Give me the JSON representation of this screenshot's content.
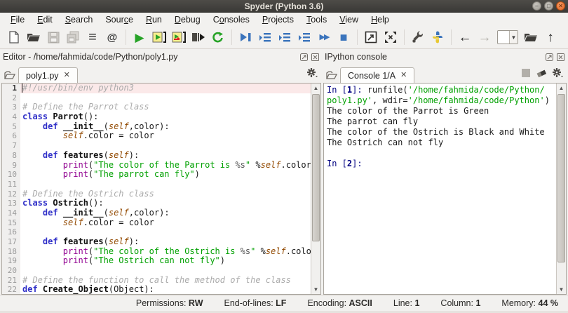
{
  "window": {
    "title": "Spyder (Python 3.6)"
  },
  "menubar": {
    "items": [
      {
        "label": "File",
        "u": 0
      },
      {
        "label": "Edit",
        "u": 0
      },
      {
        "label": "Search",
        "u": 0
      },
      {
        "label": "Source",
        "u": 4
      },
      {
        "label": "Run",
        "u": 0
      },
      {
        "label": "Debug",
        "u": 0
      },
      {
        "label": "Consoles",
        "u": 1
      },
      {
        "label": "Projects",
        "u": 0
      },
      {
        "label": "Tools",
        "u": 0
      },
      {
        "label": "View",
        "u": 0
      },
      {
        "label": "Help",
        "u": 0
      }
    ]
  },
  "toolbar": {
    "icons": [
      {
        "name": "new-file-icon",
        "kind": "doc"
      },
      {
        "name": "open-file-icon",
        "kind": "folder"
      },
      {
        "name": "save-icon",
        "kind": "floppy",
        "disabled": true
      },
      {
        "name": "save-all-icon",
        "kind": "floppy2",
        "disabled": true
      },
      {
        "name": "file-switcher-icon",
        "kind": "glyph",
        "glyph": "≡",
        "color": "#333333",
        "size": 20
      },
      {
        "name": "symbol-finder-icon",
        "kind": "glyph",
        "glyph": "@",
        "color": "#333333",
        "size": 15,
        "bold": true
      },
      {
        "name": "sep",
        "kind": "sep"
      },
      {
        "name": "run-file-icon",
        "kind": "glyph",
        "glyph": "▶",
        "color": "#27a327",
        "size": 17
      },
      {
        "name": "run-cell-icon",
        "kind": "cell"
      },
      {
        "name": "rerun-cell-icon",
        "kind": "cellr"
      },
      {
        "name": "run-selection-icon",
        "kind": "selrun"
      },
      {
        "name": "rerun-last-icon",
        "kind": "rerun"
      },
      {
        "name": "sep",
        "kind": "sep"
      },
      {
        "name": "debug-file-icon",
        "kind": "dbgplay"
      },
      {
        "name": "run-current-line-icon",
        "kind": "step"
      },
      {
        "name": "step-into-icon",
        "kind": "step"
      },
      {
        "name": "step-return-icon",
        "kind": "step"
      },
      {
        "name": "continue-execution-icon",
        "kind": "glyph",
        "glyph": "▶▶",
        "color": "#3b74bc",
        "size": 11,
        "bold": true
      },
      {
        "name": "stop-debug-icon",
        "kind": "glyph",
        "glyph": "■",
        "color": "#3b74bc",
        "size": 18
      },
      {
        "name": "sep",
        "kind": "sep"
      },
      {
        "name": "maximize-pane-icon",
        "kind": "maxpane"
      },
      {
        "name": "fullscreen-icon",
        "kind": "fullscr"
      },
      {
        "name": "sep",
        "kind": "sep"
      },
      {
        "name": "preferences-icon",
        "kind": "wrench"
      },
      {
        "name": "python-path-manager-icon",
        "kind": "python"
      },
      {
        "name": "sep",
        "kind": "sep"
      },
      {
        "name": "back-icon",
        "kind": "glyph",
        "glyph": "←",
        "color": "#222222",
        "size": 19,
        "bold": true
      },
      {
        "name": "forward-icon",
        "kind": "glyph",
        "glyph": "→",
        "color": "#b2afa9",
        "size": 19,
        "bold": true,
        "disabled": true
      },
      {
        "name": "working-directory-combobox",
        "kind": "combo"
      },
      {
        "name": "open-directory-icon",
        "kind": "folder"
      },
      {
        "name": "parent-directory-icon",
        "kind": "glyph",
        "glyph": "↑",
        "color": "#222222",
        "size": 19,
        "bold": true
      }
    ]
  },
  "editor": {
    "header": "Editor - /home/fahmida/code/Python/poly1.py",
    "tab": "poly1.py",
    "lines": [
      {
        "n": "1",
        "cur": true,
        "segs": [
          [
            "c",
            "#!/usr/bin/env python3"
          ]
        ]
      },
      {
        "n": "2",
        "segs": []
      },
      {
        "n": "3",
        "segs": [
          [
            "c",
            "# Define the Parrot class"
          ]
        ]
      },
      {
        "n": "4",
        "segs": [
          [
            "k",
            "class"
          ],
          [
            "p",
            " "
          ],
          [
            "d",
            "Parrot"
          ],
          [
            "p",
            "():"
          ]
        ]
      },
      {
        "n": "5",
        "segs": [
          [
            "p",
            "    "
          ],
          [
            "k",
            "def"
          ],
          [
            "p",
            " "
          ],
          [
            "d",
            "__init__"
          ],
          [
            "p",
            "("
          ],
          [
            "i",
            "self"
          ],
          [
            "p",
            ",color):"
          ]
        ]
      },
      {
        "n": "6",
        "segs": [
          [
            "p",
            "        "
          ],
          [
            "i",
            "self"
          ],
          [
            "p",
            ".color = color"
          ]
        ]
      },
      {
        "n": "7",
        "segs": []
      },
      {
        "n": "8",
        "segs": [
          [
            "p",
            "    "
          ],
          [
            "k",
            "def"
          ],
          [
            "p",
            " "
          ],
          [
            "d",
            "features"
          ],
          [
            "p",
            "("
          ],
          [
            "i",
            "self"
          ],
          [
            "p",
            "):"
          ]
        ]
      },
      {
        "n": "9",
        "segs": [
          [
            "p",
            "        "
          ],
          [
            "b",
            "print"
          ],
          [
            "p",
            "("
          ],
          [
            "s",
            "\"The color of the Parrot is "
          ],
          [
            "f",
            "%s"
          ],
          [
            "s",
            "\""
          ],
          [
            "p",
            " %"
          ],
          [
            "i",
            "self"
          ],
          [
            "p",
            ".color)"
          ]
        ]
      },
      {
        "n": "10",
        "segs": [
          [
            "p",
            "        "
          ],
          [
            "b",
            "print"
          ],
          [
            "p",
            "("
          ],
          [
            "s",
            "\"The parrot can fly\""
          ],
          [
            "p",
            ")"
          ]
        ]
      },
      {
        "n": "11",
        "segs": []
      },
      {
        "n": "12",
        "segs": [
          [
            "c",
            "# Define the Ostrich class"
          ]
        ]
      },
      {
        "n": "13",
        "segs": [
          [
            "k",
            "class"
          ],
          [
            "p",
            " "
          ],
          [
            "d",
            "Ostrich"
          ],
          [
            "p",
            "():"
          ]
        ]
      },
      {
        "n": "14",
        "segs": [
          [
            "p",
            "    "
          ],
          [
            "k",
            "def"
          ],
          [
            "p",
            " "
          ],
          [
            "d",
            "__init__"
          ],
          [
            "p",
            "("
          ],
          [
            "i",
            "self"
          ],
          [
            "p",
            ",color):"
          ]
        ]
      },
      {
        "n": "15",
        "segs": [
          [
            "p",
            "        "
          ],
          [
            "i",
            "self"
          ],
          [
            "p",
            ".color = color"
          ]
        ]
      },
      {
        "n": "16",
        "segs": []
      },
      {
        "n": "17",
        "segs": [
          [
            "p",
            "    "
          ],
          [
            "k",
            "def"
          ],
          [
            "p",
            " "
          ],
          [
            "d",
            "features"
          ],
          [
            "p",
            "("
          ],
          [
            "i",
            "self"
          ],
          [
            "p",
            "):"
          ]
        ]
      },
      {
        "n": "18",
        "segs": [
          [
            "p",
            "        "
          ],
          [
            "b",
            "print"
          ],
          [
            "p",
            "("
          ],
          [
            "s",
            "\"The color of the Ostrich is "
          ],
          [
            "f",
            "%s"
          ],
          [
            "s",
            "\""
          ],
          [
            "p",
            " %"
          ],
          [
            "i",
            "self"
          ],
          [
            "p",
            ".color)"
          ]
        ]
      },
      {
        "n": "19",
        "segs": [
          [
            "p",
            "        "
          ],
          [
            "b",
            "print"
          ],
          [
            "p",
            "("
          ],
          [
            "s",
            "\"The Ostrich can not fly\""
          ],
          [
            "p",
            ")"
          ]
        ]
      },
      {
        "n": "20",
        "segs": []
      },
      {
        "n": "21",
        "segs": [
          [
            "c",
            "# Define the function to call the method of the class"
          ]
        ]
      },
      {
        "n": "22",
        "segs": [
          [
            "k",
            "def"
          ],
          [
            "p",
            " "
          ],
          [
            "d",
            "Create_Object"
          ],
          [
            "p",
            "(Object):"
          ]
        ]
      }
    ]
  },
  "console": {
    "header": "IPython console",
    "tab": "Console 1/A",
    "lines": [
      {
        "segs": [
          [
            "pr",
            "In ["
          ],
          [
            "prn",
            "1"
          ],
          [
            "pr",
            "]: "
          ],
          [
            "p",
            "runfile("
          ],
          [
            "s",
            "'/home/fahmida/code/Python/"
          ]
        ]
      },
      {
        "segs": [
          [
            "s",
            "poly1.py'"
          ],
          [
            "p",
            ", wdir="
          ],
          [
            "s",
            "'/home/fahmida/code/Python'"
          ],
          [
            "p",
            ")"
          ]
        ]
      },
      {
        "segs": [
          [
            "p",
            "The color of the Parrot is Green"
          ]
        ]
      },
      {
        "segs": [
          [
            "p",
            "The parrot can fly"
          ]
        ]
      },
      {
        "segs": [
          [
            "p",
            "The color of the Ostrich is Black and White"
          ]
        ]
      },
      {
        "segs": [
          [
            "p",
            "The Ostrich can not fly"
          ]
        ]
      },
      {
        "segs": []
      },
      {
        "segs": [
          [
            "pr",
            "In ["
          ],
          [
            "prn",
            "2"
          ],
          [
            "pr",
            "]: "
          ]
        ]
      }
    ]
  },
  "statusbar": {
    "items": [
      {
        "label": "Permissions:",
        "value": "RW"
      },
      {
        "label": "End-of-lines:",
        "value": "LF"
      },
      {
        "label": "Encoding:",
        "value": "ASCII"
      },
      {
        "label": "Line:",
        "value": "1"
      },
      {
        "label": "Column:",
        "value": "1"
      },
      {
        "label": "Memory:",
        "value": "44 %"
      }
    ]
  },
  "colors": {
    "titlebar": "#3a3936",
    "accent_run": "#27a327",
    "accent_debug": "#3b74bc",
    "string": "#00a000",
    "keyword": "#3030c8",
    "builtin": "#900090",
    "comment": "#ababab",
    "instance": "#924900",
    "close_button": "#e2601f"
  }
}
